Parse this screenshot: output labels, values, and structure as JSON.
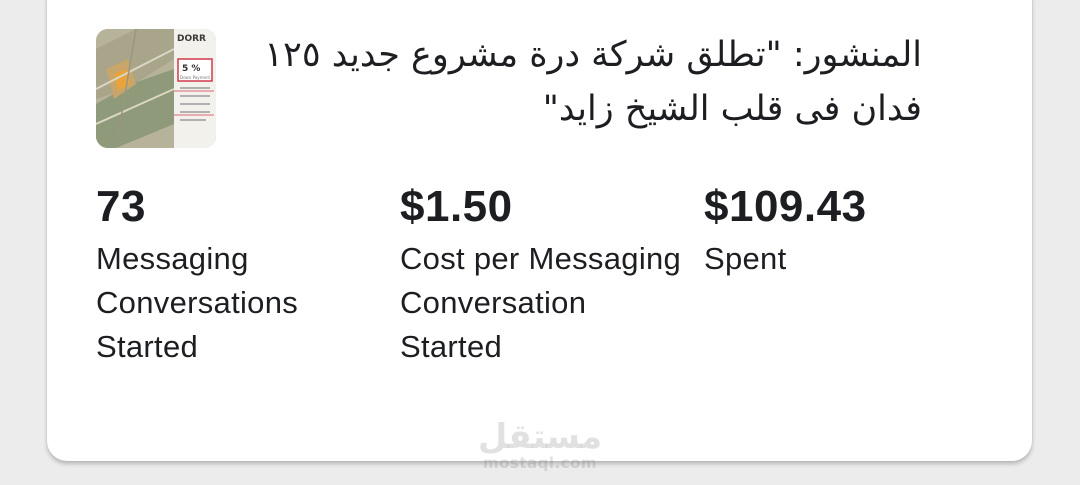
{
  "post": {
    "title": "المنشور: \"تطلق شركة درة مشروع جديد ١٢٥ فدان فى قلب الشيخ زايد\"",
    "thumbnail": {
      "brand_text": "DORR",
      "badge_text": "5 %",
      "badge_subtext": "Down Payment"
    }
  },
  "stats": [
    {
      "value": "73",
      "label": "Messaging Conversations Started"
    },
    {
      "value": "$1.50",
      "label": "Cost per Messaging Conversation Started"
    },
    {
      "value": "$109.43",
      "label": "Spent"
    }
  ],
  "watermark": {
    "logo_text": "مستقل",
    "url": "mostaql.com"
  }
}
